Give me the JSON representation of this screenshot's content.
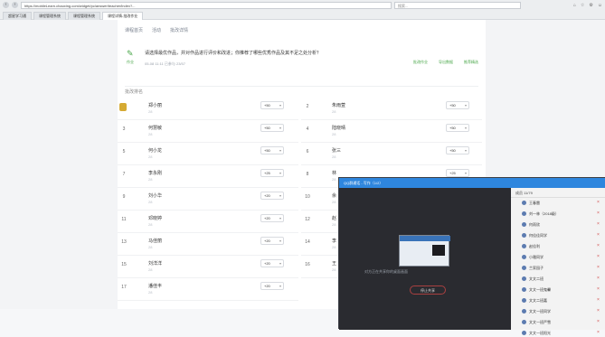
{
  "browser": {
    "url": "https://mobileLearn.chaoxing.com/widget/pc/answer/teacher/index?...",
    "search_placeholder": "搜索...",
    "tabs": [
      "超星学习通",
      "课程管理系统",
      "课程管理系统",
      "课程详情-批改作业"
    ]
  },
  "breadcrumb": [
    "课程首页",
    "活动",
    "批改详情"
  ],
  "task": {
    "icon": "✎",
    "type": "作业",
    "text": "请选择最优作品，并对作品进行评价和改进；你推荐了哪些优秀作品及其不足之处分析？",
    "meta": "05-08 11:11    已参与 23/57",
    "actions": [
      "批改作业",
      "导出数据",
      "推荐精选"
    ]
  },
  "section_title": "批改排名",
  "rows": [
    {
      "rank": "",
      "name": "郑小丽",
      "sub": "28",
      "score": "+50"
    },
    {
      "rank": "2",
      "name": "朱雨萱",
      "sub": "28",
      "score": "+50"
    },
    {
      "rank": "3",
      "name": "何慧敏",
      "sub": "28",
      "score": "+50"
    },
    {
      "rank": "4",
      "name": "陆晓晴",
      "sub": "28",
      "score": "+50"
    },
    {
      "rank": "5",
      "name": "何小龙",
      "sub": "28",
      "score": "+50"
    },
    {
      "rank": "6",
      "name": "张三",
      "sub": "28",
      "score": "+50"
    },
    {
      "rank": "7",
      "name": "李永刚",
      "sub": "28",
      "score": "+25"
    },
    {
      "rank": "8",
      "name": "林",
      "sub": "28",
      "score": "+25"
    },
    {
      "rank": "9",
      "name": "刘小华",
      "sub": "28",
      "score": "+20"
    },
    {
      "rank": "10",
      "name": "余",
      "sub": "28",
      "score": "+20"
    },
    {
      "rank": "11",
      "name": "邓晓婷",
      "sub": "28",
      "score": "+20"
    },
    {
      "rank": "12",
      "name": "赵",
      "sub": "28",
      "score": "+20"
    },
    {
      "rank": "13",
      "name": "马佳丽",
      "sub": "28",
      "score": "+20"
    },
    {
      "rank": "14",
      "name": "李",
      "sub": "28",
      "score": "+20"
    },
    {
      "rank": "15",
      "name": "刘洋洋",
      "sub": "28",
      "score": "+20"
    },
    {
      "rank": "16",
      "name": "王",
      "sub": "28",
      "score": "+20"
    },
    {
      "rank": "17",
      "name": "潘佳丰",
      "sub": "28",
      "score": "+20"
    }
  ],
  "meeting": {
    "title": "QQ群通话 - 写作（1/2）",
    "share_text": "对方正在共享你的桌面画面",
    "stop_label": "停止共享",
    "members_title": "成员 11/79",
    "members": [
      "王春雷",
      "刘一林（2018级）",
      "何雨欣",
      "何佳佳同学",
      "赵佳利",
      "小雅同学",
      "兰家园子",
      "文文二班",
      "文文一班鬼馨",
      "文文二班嘉",
      "文文一班同学",
      "文文一班严雪",
      "文文一班阳光"
    ]
  }
}
